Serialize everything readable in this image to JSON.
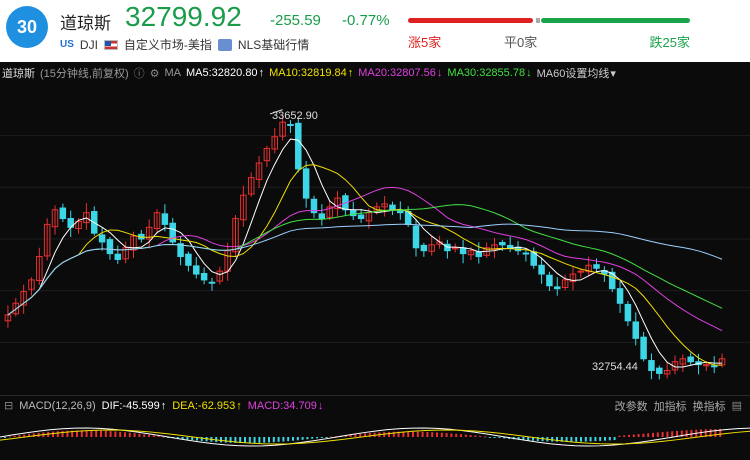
{
  "header": {
    "badge": "30",
    "name": "道琼斯",
    "price": "32799.92",
    "change": "-255.59",
    "change_pct": "-0.77%",
    "us_tag": "US",
    "code": "DJI",
    "market": "自定义市场-美指",
    "source": "NLS基础行情",
    "up_count": "涨5家",
    "flat_count": "平0家",
    "down_count": "跌25家",
    "colors": {
      "up": "#e02020",
      "down": "#1aa34a",
      "accent": "#1f8fe0"
    }
  },
  "ma_bar": {
    "name": "道琼斯",
    "period": "(15分钟线,前复权)",
    "ma_label": "MA",
    "ma5": "MA5:32820.80",
    "ma10": "MA10:32819.84",
    "ma20": "MA20:32807.56",
    "ma30": "MA30:32855.78",
    "ma60": "MA60设置均线",
    "arrows": {
      "ma5": "↑",
      "ma10": "↑",
      "ma20": "↓",
      "ma30": "↓",
      "ma60": "▾"
    },
    "colors": {
      "ma5": "#ffffff",
      "ma10": "#f0e000",
      "ma20": "#e040e0",
      "ma30": "#40e040",
      "ma60": "#cccccc"
    }
  },
  "chart_labels": {
    "high": "33652.90",
    "low": "32754.44"
  },
  "macd_bar": {
    "label": "MACD(12,26,9)",
    "dif": "DIF:-45.599",
    "dea": "DEA:-62.953",
    "macd": "MACD:34.709",
    "dif_arrow": "↑",
    "dea_arrow": "↑",
    "macd_arrow": "↓",
    "tools": [
      "改参数",
      "加指标",
      "换指标"
    ]
  },
  "chart_data": {
    "type": "candlestick",
    "interval": "15分钟线",
    "high_marker": 33652.9,
    "low_marker": 32754.44,
    "ylim": [
      32700,
      33720
    ],
    "close_series": [
      32950,
      32990,
      33030,
      33070,
      33150,
      33260,
      33310,
      33280,
      33250,
      33270,
      33300,
      33230,
      33200,
      33160,
      33140,
      33180,
      33220,
      33210,
      33250,
      33300,
      33260,
      33200,
      33150,
      33120,
      33090,
      33070,
      33060,
      33100,
      33170,
      33280,
      33360,
      33420,
      33470,
      33520,
      33560,
      33610,
      33600,
      33450,
      33350,
      33300,
      33280,
      33320,
      33350,
      33310,
      33290,
      33280,
      33300,
      33320,
      33330,
      33310,
      33300,
      33260,
      33180,
      33170,
      33190,
      33200,
      33170,
      33180,
      33160,
      33170,
      33150,
      33180,
      33190,
      33190,
      33180,
      33170,
      33160,
      33120,
      33090,
      33050,
      33040,
      33070,
      33090,
      33100,
      33120,
      33110,
      33090,
      33040,
      32990,
      32930,
      32870,
      32800,
      32760,
      32750,
      32760,
      32790,
      32800,
      32790,
      32780,
      32780,
      32775,
      32800
    ]
  }
}
